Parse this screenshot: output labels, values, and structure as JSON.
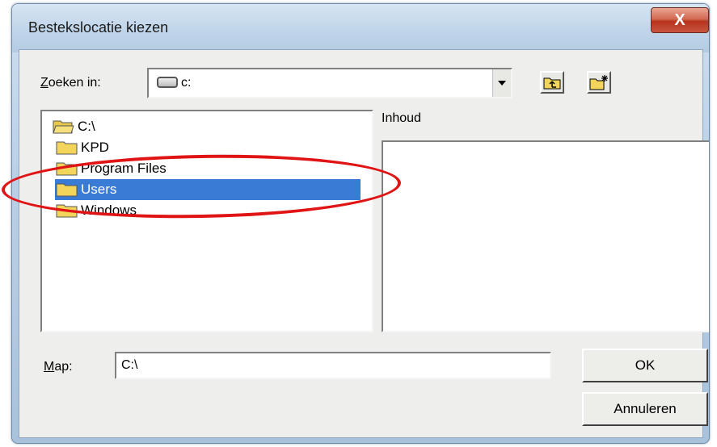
{
  "window": {
    "title": "Bestekslocatie kiezen",
    "close_glyph": "X"
  },
  "lookin": {
    "label": "Zoeken in:",
    "mnemonic": "Z",
    "rest": "oeken in:",
    "value": "c:"
  },
  "tree": {
    "items": [
      {
        "label": "C:\\",
        "icon": "open-folder-icon"
      },
      {
        "label": "KPD",
        "icon": "folder-icon"
      },
      {
        "label": "Program Files",
        "icon": "folder-icon"
      },
      {
        "label": "Users",
        "icon": "folder-icon",
        "selected": true
      },
      {
        "label": "Windows",
        "icon": "folder-icon"
      }
    ]
  },
  "contents": {
    "label": "Inhoud"
  },
  "map": {
    "mnemonic": "M",
    "rest": "ap:",
    "value": "C:\\"
  },
  "buttons": {
    "ok": "OK",
    "cancel": "Annuleren"
  },
  "colors": {
    "highlight": "#3a7bd5",
    "annotation": "#e01414"
  }
}
